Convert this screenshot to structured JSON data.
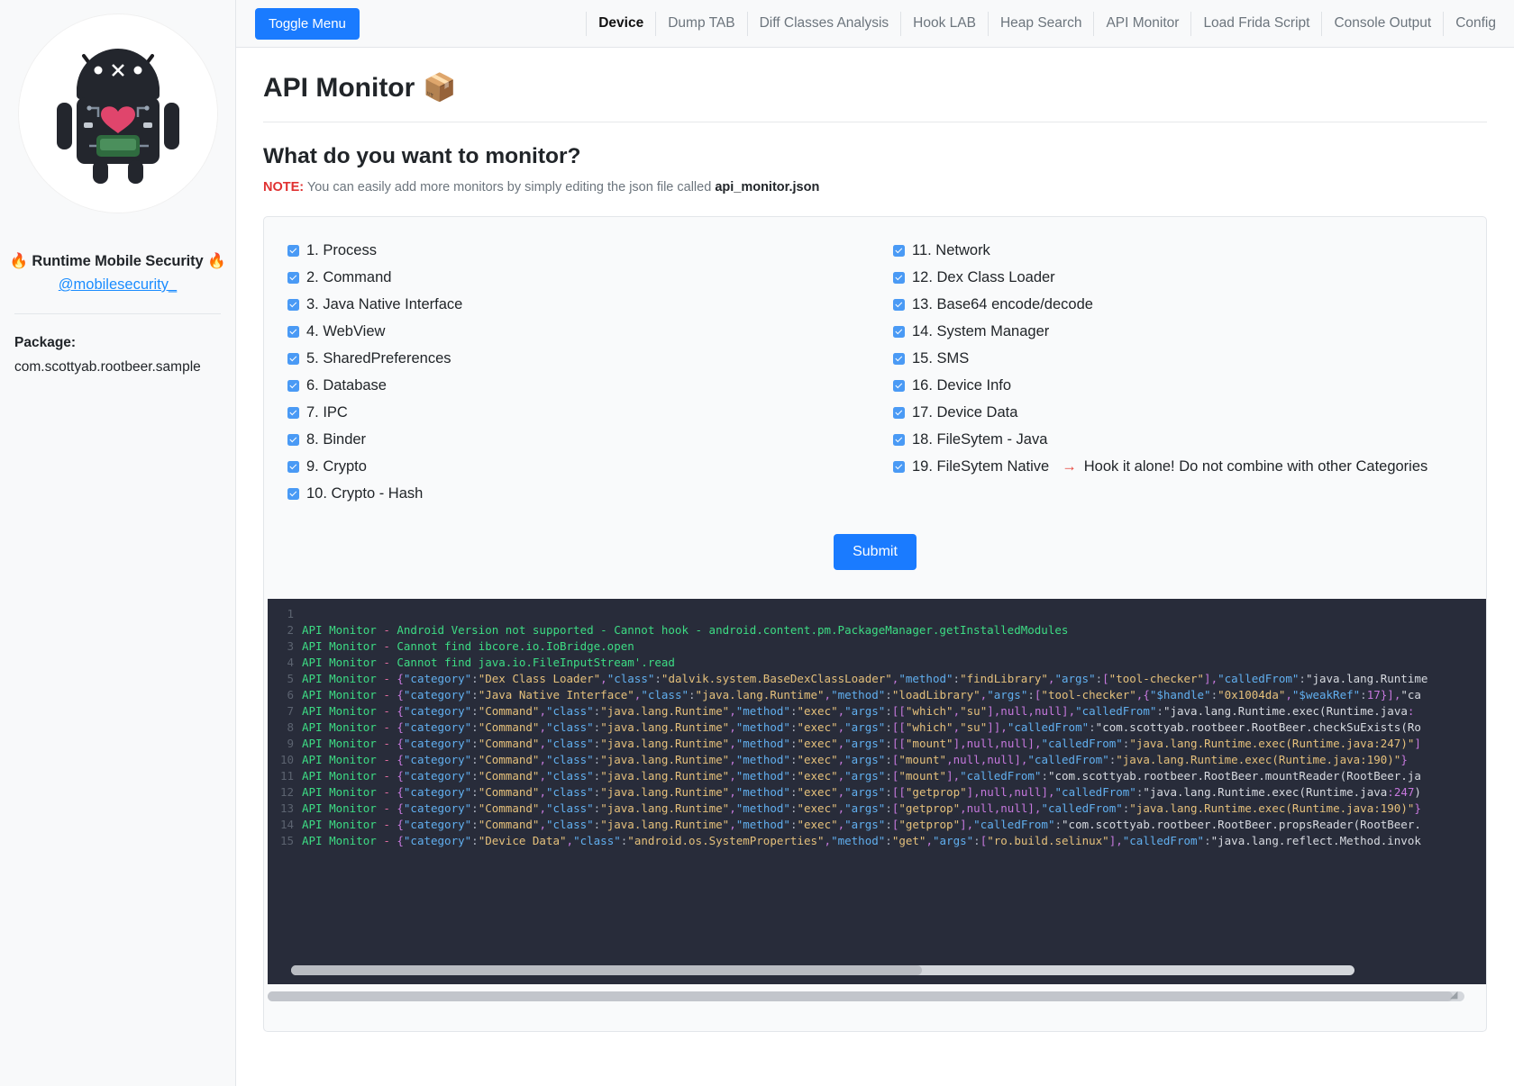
{
  "sidebar": {
    "avatar_name": "android-robot-avatar",
    "brand": "🔥 Runtime Mobile Security 🔥",
    "handle": "@mobilesecurity_",
    "package_label": "Package:",
    "package_value": "com.scottyab.rootbeer.sample"
  },
  "topbar": {
    "toggle_label": "Toggle Menu",
    "tabs": [
      {
        "label": "Device",
        "active": true
      },
      {
        "label": "Dump TAB",
        "active": false
      },
      {
        "label": "Diff Classes Analysis",
        "active": false
      },
      {
        "label": "Hook LAB",
        "active": false
      },
      {
        "label": "Heap Search",
        "active": false
      },
      {
        "label": "API Monitor",
        "active": false
      },
      {
        "label": "Load Frida Script",
        "active": false
      },
      {
        "label": "Console Output",
        "active": false
      },
      {
        "label": "Config",
        "active": false
      }
    ]
  },
  "page": {
    "title": "API Monitor",
    "title_emoji": "📦",
    "question": "What do you want to monitor?",
    "note_key": "NOTE:",
    "note_text": " You can easily add more monitors by simply editing the json file called ",
    "note_file": "api_monitor.json",
    "submit_label": "Submit"
  },
  "monitors": {
    "left": [
      {
        "label": "1. Process",
        "checked": true
      },
      {
        "label": "2. Command",
        "checked": true
      },
      {
        "label": "3. Java Native Interface",
        "checked": true
      },
      {
        "label": "4. WebView",
        "checked": true
      },
      {
        "label": "5. SharedPreferences",
        "checked": true
      },
      {
        "label": "6. Database",
        "checked": true
      },
      {
        "label": "7. IPC",
        "checked": true
      },
      {
        "label": "8. Binder",
        "checked": true
      },
      {
        "label": "9. Crypto",
        "checked": true
      },
      {
        "label": "10. Crypto - Hash",
        "checked": true
      }
    ],
    "right": [
      {
        "label": "11. Network",
        "checked": true
      },
      {
        "label": "12. Dex Class Loader",
        "checked": true
      },
      {
        "label": "13. Base64 encode/decode",
        "checked": true
      },
      {
        "label": "14. System Manager",
        "checked": true
      },
      {
        "label": "15. SMS",
        "checked": true
      },
      {
        "label": "16. Device Info",
        "checked": true
      },
      {
        "label": "17. Device Data",
        "checked": true
      },
      {
        "label": "18. FileSytem - Java",
        "checked": true
      },
      {
        "label": "19. FileSytem Native",
        "checked": true,
        "suffix_arrow": "→",
        "suffix": " Hook it alone! Do not combine with other Categories"
      }
    ]
  },
  "console": {
    "lines": [
      {
        "n": "1",
        "text": ""
      },
      {
        "n": "2",
        "text": "API Monitor - Android Version not supported - Cannot hook - android.content.pm.PackageManager.getInstalledModules"
      },
      {
        "n": "3",
        "text": "API Monitor - Cannot find ibcore.io.IoBridge.open"
      },
      {
        "n": "4",
        "text": "API Monitor - Cannot find java.io.FileInputStream'.read"
      },
      {
        "n": "5",
        "text": "API Monitor - {\"category\":\"Dex Class Loader\",\"class\":\"dalvik.system.BaseDexClassLoader\",\"method\":\"findLibrary\",\"args\":[\"tool-checker\"],\"calledFrom\":\"java.lang.Runtime"
      },
      {
        "n": "6",
        "text": "API Monitor - {\"category\":\"Java Native Interface\",\"class\":\"java.lang.Runtime\",\"method\":\"loadLibrary\",\"args\":[\"tool-checker\",{\"$handle\":\"0x1004da\",\"$weakRef\":17}],\"ca"
      },
      {
        "n": "7",
        "text": "API Monitor - {\"category\":\"Command\",\"class\":\"java.lang.Runtime\",\"method\":\"exec\",\"args\":[[\"which\",\"su\"],null,null],\"calledFrom\":\"java.lang.Runtime.exec(Runtime.java:"
      },
      {
        "n": "8",
        "text": "API Monitor - {\"category\":\"Command\",\"class\":\"java.lang.Runtime\",\"method\":\"exec\",\"args\":[[\"which\",\"su\"]],\"calledFrom\":\"com.scottyab.rootbeer.RootBeer.checkSuExists(Ro"
      },
      {
        "n": "9",
        "text": "API Monitor - {\"category\":\"Command\",\"class\":\"java.lang.Runtime\",\"method\":\"exec\",\"args\":[[\"mount\"],null,null],\"calledFrom\":\"java.lang.Runtime.exec(Runtime.java:247)\"]"
      },
      {
        "n": "10",
        "text": "API Monitor - {\"category\":\"Command\",\"class\":\"java.lang.Runtime\",\"method\":\"exec\",\"args\":[\"mount\",null,null],\"calledFrom\":\"java.lang.Runtime.exec(Runtime.java:190)\"}"
      },
      {
        "n": "11",
        "text": "API Monitor - {\"category\":\"Command\",\"class\":\"java.lang.Runtime\",\"method\":\"exec\",\"args\":[\"mount\"],\"calledFrom\":\"com.scottyab.rootbeer.RootBeer.mountReader(RootBeer.ja"
      },
      {
        "n": "12",
        "text": "API Monitor - {\"category\":\"Command\",\"class\":\"java.lang.Runtime\",\"method\":\"exec\",\"args\":[[\"getprop\"],null,null],\"calledFrom\":\"java.lang.Runtime.exec(Runtime.java:247)"
      },
      {
        "n": "13",
        "text": "API Monitor - {\"category\":\"Command\",\"class\":\"java.lang.Runtime\",\"method\":\"exec\",\"args\":[\"getprop\",null,null],\"calledFrom\":\"java.lang.Runtime.exec(Runtime.java:190)\"}"
      },
      {
        "n": "14",
        "text": "API Monitor - {\"category\":\"Command\",\"class\":\"java.lang.Runtime\",\"method\":\"exec\",\"args\":[\"getprop\"],\"calledFrom\":\"com.scottyab.rootbeer.RootBeer.propsReader(RootBeer."
      },
      {
        "n": "15",
        "text": "API Monitor - {\"category\":\"Device Data\",\"class\":\"android.os.SystemProperties\",\"method\":\"get\",\"args\":[\"ro.build.selinux\"],\"calledFrom\":\"java.lang.reflect.Method.invok"
      }
    ]
  },
  "colors": {
    "accent": "#1a7bff",
    "link": "#1a8cff",
    "checkbox": "#4a9af5",
    "note": "#e03131",
    "arrow": "#e8453c",
    "console_bg": "#282c3a"
  }
}
